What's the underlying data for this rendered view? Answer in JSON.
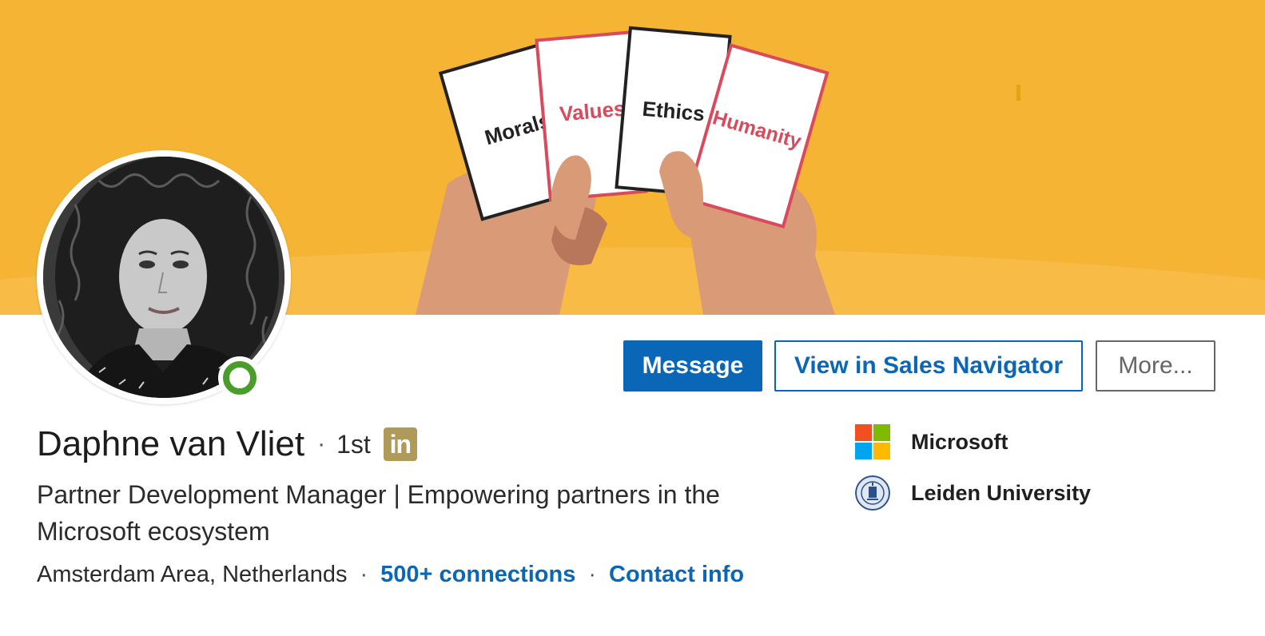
{
  "banner": {
    "cards": [
      "Morals",
      "Values",
      "Ethics",
      "Humanity"
    ]
  },
  "profile": {
    "name": "Daphne van Vliet",
    "separator": "·",
    "degree": "1st",
    "premium_badge": "in",
    "headline": "Partner Development Manager | Empowering partners in the Microsoft ecosystem",
    "location": "Amsterdam Area, Netherlands",
    "connections": "500+ connections",
    "contact_info": "Contact info"
  },
  "actions": {
    "message": "Message",
    "sales_navigator": "View in Sales Navigator",
    "more": "More..."
  },
  "organizations": [
    {
      "name": "Microsoft",
      "logo": "microsoft-logo"
    },
    {
      "name": "Leiden University",
      "logo": "leiden-university-seal"
    }
  ],
  "colors": {
    "banner": "#f5b433",
    "primary": "#0a66b7",
    "presence": "#4a9d2a",
    "premium": "#b09a5a"
  }
}
